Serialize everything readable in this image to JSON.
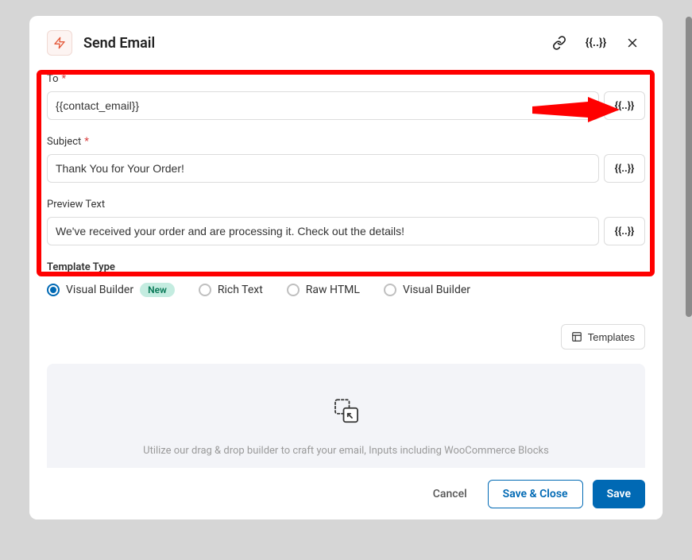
{
  "header": {
    "title": "Send Email"
  },
  "fields": {
    "to": {
      "label": "To",
      "value": "{{contact_email}}"
    },
    "subject": {
      "label": "Subject",
      "value": "Thank You for Your Order!"
    },
    "preview": {
      "label": "Preview Text",
      "value": "We've received your order and are processing it. Check out the details!"
    }
  },
  "templateType": {
    "heading": "Template Type",
    "options": [
      "Visual Builder",
      "Rich Text",
      "Raw HTML",
      "Visual Builder"
    ],
    "newBadge": "New"
  },
  "templatesBtn": "Templates",
  "canvas": {
    "helper": "Utilize our drag & drop builder to craft your email, Inputs including WooCommerce Blocks"
  },
  "footer": {
    "cancel": "Cancel",
    "saveClose": "Save & Close",
    "save": "Save"
  },
  "varToken": "{{..}}"
}
